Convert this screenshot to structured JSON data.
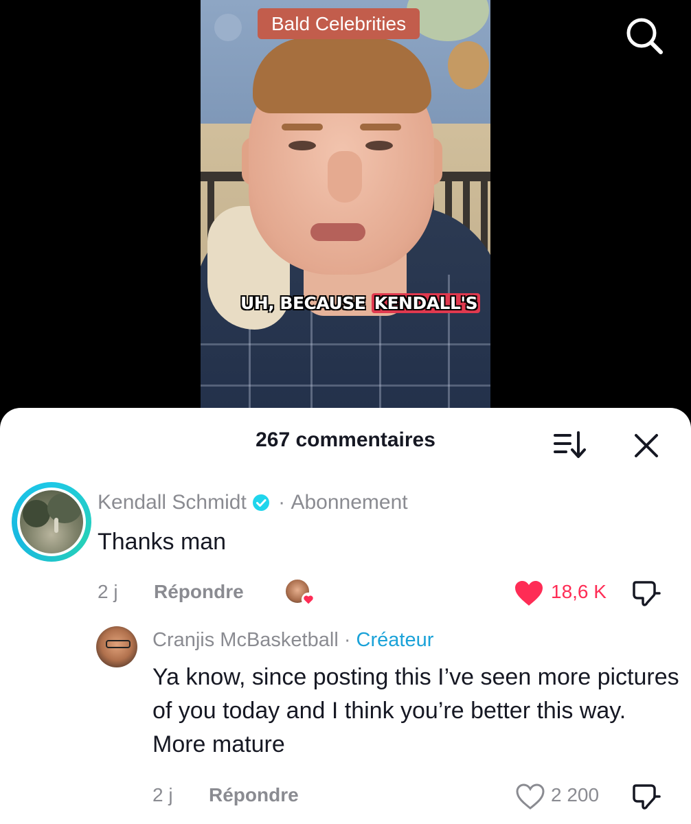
{
  "video": {
    "overlay_title": "Bald Celebrities",
    "caption_before": "UH, BECAUSE ",
    "caption_highlight": "KENDALL'S",
    "search_icon": "search-icon"
  },
  "comments_panel": {
    "count_label": "267 commentaires",
    "sort_icon": "sort-icon",
    "close_icon": "close-icon"
  },
  "comment": {
    "author": "Kendall Schmidt",
    "separator": " · ",
    "follow_label": "Abonnement",
    "text": "Thanks man",
    "time": "2 j",
    "reply_label": "Répondre",
    "likes": "18,6 K",
    "liked": true,
    "like_color": "#fe2c55",
    "ring_color": "#1ec8e6"
  },
  "reply": {
    "author": "Cranjis McBasketball",
    "separator": " · ",
    "badge": "Créateur",
    "badge_color": "#1aa2d8",
    "text": "Ya know, since posting this I’ve seen more pictures of you today and I think you’re better this way. More mature",
    "time": "2 j",
    "reply_label": "Répondre",
    "likes": "2 200",
    "liked": false
  }
}
